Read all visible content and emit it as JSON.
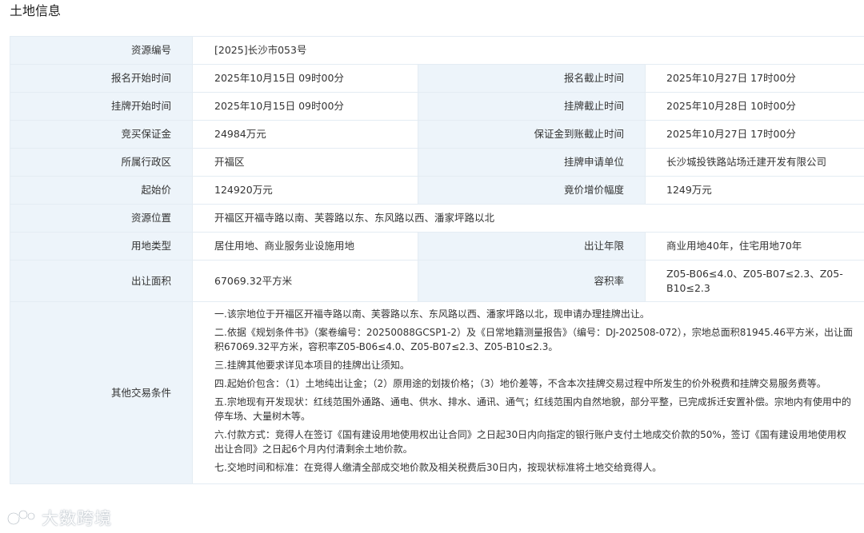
{
  "page": {
    "title": "土地信息"
  },
  "rows": {
    "resource_no": {
      "label": "资源编号",
      "value": "[2025]长沙市053号"
    },
    "reg_start": {
      "label": "报名开始时间",
      "value": "2025年10月15日 09时00分"
    },
    "reg_end": {
      "label": "报名截止时间",
      "value": "2025年10月27日 17时00分"
    },
    "listing_start": {
      "label": "挂牌开始时间",
      "value": "2025年10月15日 09时00分"
    },
    "listing_end": {
      "label": "挂牌截止时间",
      "value": "2025年10月28日 10时00分"
    },
    "deposit": {
      "label": "竞买保证金",
      "value": "24984万元"
    },
    "deposit_deadline": {
      "label": "保证金到账截止时间",
      "value": "2025年10月27日 17时00分"
    },
    "district": {
      "label": "所属行政区",
      "value": "开福区"
    },
    "applicant": {
      "label": "挂牌申请单位",
      "value": "长沙城投铁路站场迁建开发有限公司"
    },
    "start_price": {
      "label": "起始价",
      "value": "124920万元"
    },
    "bid_increment": {
      "label": "竟价增价幅度",
      "value": "1249万元"
    },
    "location": {
      "label": "资源位置",
      "value": "开福区开福寺路以南、芙蓉路以东、东风路以西、潘家坪路以北"
    },
    "land_use": {
      "label": "用地类型",
      "value": "居住用地、商业服务业设施用地"
    },
    "term": {
      "label": "出让年限",
      "value": "商业用地40年，住宅用地70年"
    },
    "area": {
      "label": "出让面积",
      "value": "67069.32平方米"
    },
    "far": {
      "label": "容积率",
      "value": "Z05-B06≤4.0、Z05-B07≤2.3、Z05-B10≤2.3"
    },
    "other_conditions": {
      "label": "其他交易条件",
      "items": [
        "一.该宗地位于开福区开福寺路以南、芙蓉路以东、东风路以西、潘家坪路以北，现申请办理挂牌出让。",
        "二.依据《规划条件书》（案卷编号：20250088GCSP1-2）及《日常地籍测量报告》（编号：DJ-202508-072），宗地总面积81945.46平方米，出让面积67069.32平方米，容积率Z05-B06≤4.0、Z05-B07≤2.3、Z05-B10≤2.3。",
        "三.挂牌其他要求详见本项目的挂牌出让须知。",
        "四.起始价包含：（1）土地纯出让金；（2）原用途的划拨价格；（3）地价差等，不含本次挂牌交易过程中所发生的价外税费和挂牌交易服务费等。",
        "五.宗地现有开发现状：红线范围外通路、通电、供水、排水、通讯、通气；红线范围内自然地貌，部分平整，已完成拆迁安置补偿。宗地内有使用中的停车场、大量树木等。",
        "六.付款方式：竞得人在签订《国有建设用地使用权出让合同》之日起30日内向指定的银行账户支付土地成交价款的50%，签订《国有建设用地使用权出让合同》之日起6个月内付清剩余土地价款。",
        "七.交地时间和标准：在竞得人缴清全部成交地价款及相关税费后30日内，按现状标准将土地交给竟得人。"
      ]
    }
  },
  "watermark": {
    "text": "大数跨境"
  },
  "colors": {
    "label_bg": "#edf4fa",
    "border": "#e4ecf3"
  }
}
